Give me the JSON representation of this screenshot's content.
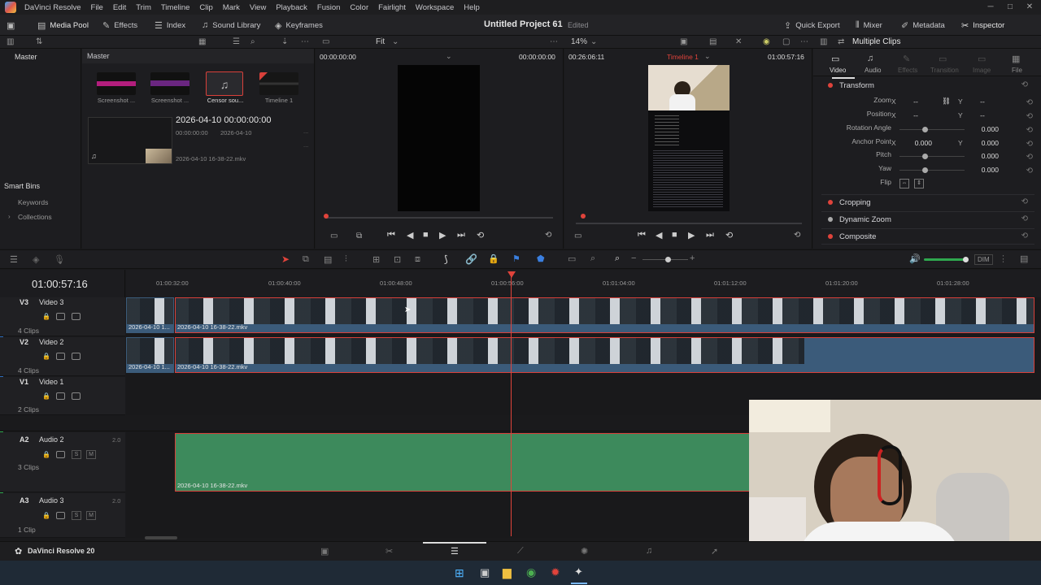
{
  "menubar": {
    "app_name": "DaVinci Resolve",
    "items": [
      "File",
      "Edit",
      "Trim",
      "Timeline",
      "Clip",
      "Mark",
      "View",
      "Playback",
      "Fusion",
      "Color",
      "Fairlight",
      "Workspace",
      "Help"
    ]
  },
  "toolbar": {
    "media_pool": "Media Pool",
    "effects": "Effects",
    "index": "Index",
    "sound_library": "Sound Library",
    "keyframes": "Keyframes",
    "project_title": "Untitled Project 61",
    "edited": "Edited",
    "quick_export": "Quick Export",
    "mixer": "Mixer",
    "metadata": "Metadata",
    "inspector": "Inspector"
  },
  "subbar": {
    "fit": "Fit",
    "zoom": "14%",
    "multiple_clips": "Multiple Clips"
  },
  "bins": {
    "master": "Master",
    "smart_bins": "Smart Bins",
    "keywords": "Keywords",
    "collections": "Collections"
  },
  "media_pool": {
    "header": "Master",
    "clips": [
      {
        "label": "Screenshot ..."
      },
      {
        "label": "Screenshot ..."
      },
      {
        "label": "Censor sou..."
      },
      {
        "label": "Timeline 1"
      }
    ],
    "detail": {
      "title": "2026-04-10  00:00:00:00",
      "start": "00:00:00:00",
      "date": "2026-04-10",
      "dash1": "...",
      "dash2": "...",
      "filename": "2026-04-10 16-38-22.mkv"
    }
  },
  "source_viewer": {
    "timecode_left": "00:00:00:00",
    "timecode_right": "00:00:00:00"
  },
  "timeline_viewer": {
    "duration": "00:26:06:11",
    "timeline_name": "Timeline 1",
    "timecode": "01:00:57:16"
  },
  "inspector": {
    "tabs": [
      "Video",
      "Audio",
      "Effects",
      "Transition",
      "Image",
      "File"
    ],
    "transform": {
      "title": "Transform",
      "zoom_label": "Zoom",
      "zoom_x": "--",
      "zoom_y": "--",
      "position_label": "Position",
      "position_x": "--",
      "position_y": "--",
      "rotation_label": "Rotation Angle",
      "rotation": "0.000",
      "anchor_label": "Anchor Point",
      "anchor_x": "0.000",
      "anchor_y": "0.000",
      "pitch_label": "Pitch",
      "pitch": "0.000",
      "yaw_label": "Yaw",
      "yaw": "0.000",
      "flip_label": "Flip",
      "x": "X",
      "y": "Y"
    },
    "sections": [
      "Cropping",
      "Dynamic Zoom",
      "Composite"
    ]
  },
  "timeline": {
    "timecode": "01:00:57:16",
    "ruler": [
      "01:00:32:00",
      "01:00:40:00",
      "01:00:48:00",
      "01:00:56:00",
      "01:01:04:00",
      "01:01:12:00",
      "01:01:20:00",
      "01:01:28:00"
    ],
    "dim": "DIM",
    "tracks": [
      {
        "id": "V3",
        "name": "Video 3",
        "clips": "4 Clips"
      },
      {
        "id": "V2",
        "name": "Video 2",
        "clips": "4 Clips"
      },
      {
        "id": "V1",
        "name": "Video 1",
        "clips": "2 Clips"
      },
      {
        "id": "A2",
        "name": "Audio 2",
        "clips": "3 Clips",
        "channels": "2.0"
      },
      {
        "id": "A3",
        "name": "Audio 3",
        "clips": "1 Clip",
        "channels": "2.0"
      }
    ],
    "clip_short": "2026-04-10 1...",
    "clip_full": "2026-04-10 16-38-22.mkv",
    "solo": "S",
    "mute": "M"
  },
  "pagebar": {
    "brand": "DaVinci Resolve 20"
  },
  "colors": {
    "accent_red": "#d9403a",
    "clip_blue": "#3b5b7a",
    "audio_green": "#3d8a5c",
    "playhead": "#e0433b"
  }
}
